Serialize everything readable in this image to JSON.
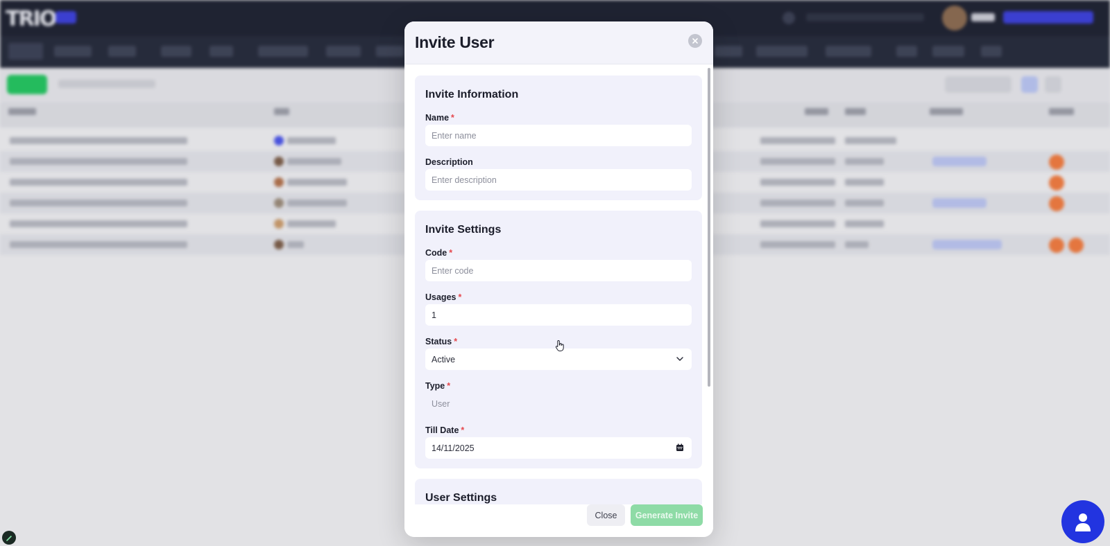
{
  "modal": {
    "title": "Invite User",
    "sections": {
      "info": {
        "title": "Invite Information",
        "name_label": "Name",
        "name_placeholder": "Enter name",
        "description_label": "Description",
        "description_placeholder": "Enter description"
      },
      "settings": {
        "title": "Invite Settings",
        "code_label": "Code",
        "code_placeholder": "Enter code",
        "usages_label": "Usages",
        "usages_value": "1",
        "status_label": "Status",
        "status_value": "Active",
        "type_label": "Type",
        "type_value": "User",
        "till_date_label": "Till Date",
        "till_date_value": "14/11/2025"
      },
      "user_settings": {
        "title": "User Settings"
      }
    },
    "required_marker": "*",
    "footer": {
      "close_label": "Close",
      "generate_label": "Generate Invite"
    }
  },
  "colors": {
    "accent_green": "#8edba6",
    "required": "#e5484d",
    "fab_blue": "#2234e0",
    "topbar": "#1d2130"
  },
  "icons": {
    "modal_close": "close-icon",
    "status_dropdown": "chevron-down-icon",
    "till_date": "calendar-icon",
    "fab": "support-agent-icon",
    "corner": "edit-icon"
  }
}
